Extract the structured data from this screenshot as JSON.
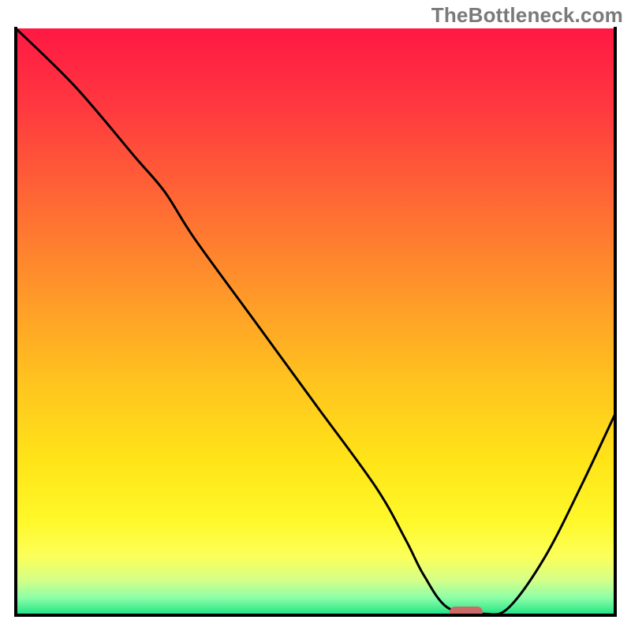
{
  "watermark": {
    "text": "TheBottleneck.com"
  },
  "colors": {
    "gradient_stops": [
      {
        "offset": 0.0,
        "color": "#ff1844"
      },
      {
        "offset": 0.14,
        "color": "#ff3a3f"
      },
      {
        "offset": 0.3,
        "color": "#ff6a34"
      },
      {
        "offset": 0.46,
        "color": "#ff9a29"
      },
      {
        "offset": 0.6,
        "color": "#ffc31f"
      },
      {
        "offset": 0.74,
        "color": "#ffe518"
      },
      {
        "offset": 0.84,
        "color": "#fff82a"
      },
      {
        "offset": 0.9,
        "color": "#fcff5a"
      },
      {
        "offset": 0.94,
        "color": "#d5ff88"
      },
      {
        "offset": 0.97,
        "color": "#8dffa8"
      },
      {
        "offset": 1.0,
        "color": "#1de183"
      }
    ],
    "curve": "#000000",
    "frame": "#000000",
    "marker": "#cc6a6a"
  },
  "chart_data": {
    "type": "line",
    "title": "",
    "xlabel": "",
    "ylabel": "",
    "xlim": [
      0,
      100
    ],
    "ylim": [
      0,
      100
    ],
    "grid": false,
    "series": [
      {
        "name": "bottleneck-curve",
        "x": [
          0,
          10,
          20,
          25,
          30,
          40,
          50,
          60,
          65,
          68,
          72,
          78,
          82,
          88,
          94,
          100
        ],
        "values": [
          100,
          90,
          78,
          72,
          64,
          50,
          36,
          22,
          13,
          7,
          1.5,
          0.5,
          1.5,
          10,
          22,
          35
        ]
      }
    ],
    "annotations": [
      {
        "name": "optimal-marker",
        "x": 75,
        "y": 0.8,
        "shape": "rounded-bar"
      }
    ]
  }
}
